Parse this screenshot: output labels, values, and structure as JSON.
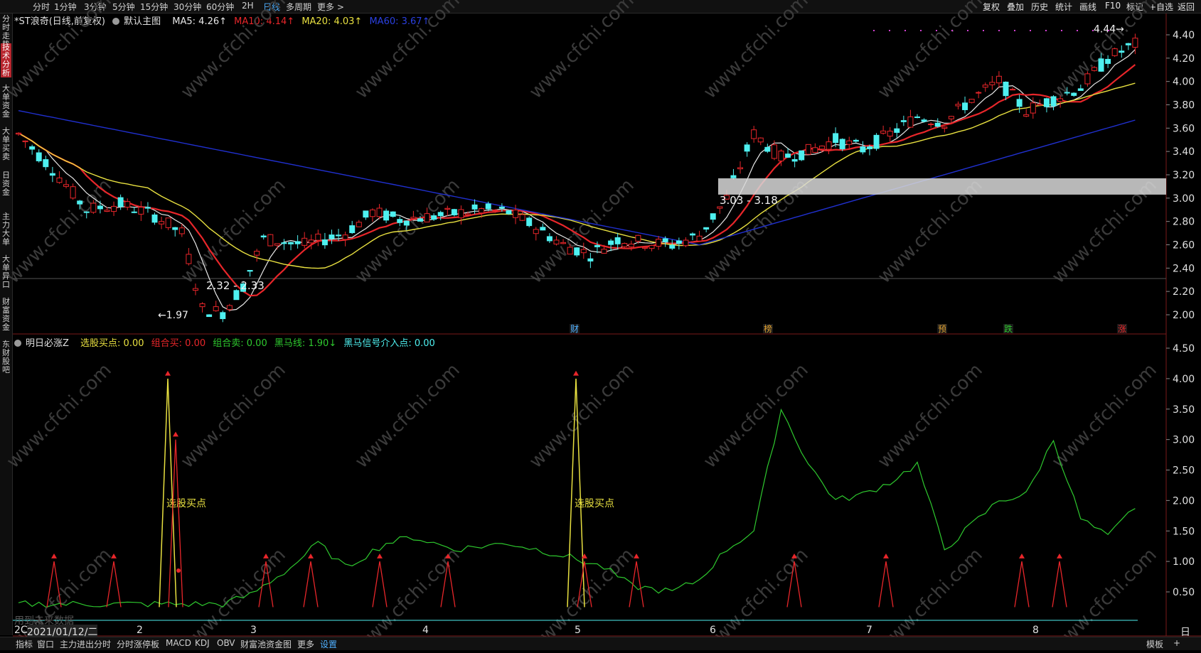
{
  "topbar": {
    "left_tabs": [
      "分时",
      "1分钟",
      "3分钟",
      "5分钟",
      "15分钟",
      "30分钟",
      "60分钟",
      "2H",
      "日线",
      "多周期",
      "更多 >"
    ],
    "active_tab": "日线",
    "right_tabs": [
      "复权",
      "叠加",
      "历史",
      "统计",
      "画线",
      "F10",
      "标记",
      "+自选",
      "返回"
    ]
  },
  "sidebar": {
    "items": [
      "分时走势",
      "技术分析",
      "大单资金",
      "大单买卖",
      "日资金",
      "主力大单",
      "大单异口",
      "财富资金",
      "东财股吧"
    ],
    "active_index": 1
  },
  "main": {
    "stock_title": "*ST浪奇(日线,前复权)",
    "template_label": "默认主图",
    "ma5": "MA5: 4.26↑",
    "ma10": "MA10: 4.14↑",
    "ma20": "MA20: 4.03↑",
    "ma60": "MA60: 3.67↑",
    "colors": {
      "up": "#e8262a",
      "down": "#4ef0f0",
      "ma5": "#e8e8e8",
      "ma10": "#e8262a",
      "ma20": "#e8e040",
      "ma60": "#2030d0",
      "grid": "#7a1a1a"
    },
    "y_ticks": [
      "4.40",
      "4.20",
      "4.00",
      "3.80",
      "3.60",
      "3.40",
      "3.20",
      "3.00",
      "2.80",
      "2.60",
      "2.40",
      "2.20",
      "2.00"
    ],
    "annotations": {
      "high": "4.44",
      "low": "1.97",
      "range1": "2.32 - 2.33",
      "range2": "3.03 - 3.18"
    },
    "event_tags": [
      "财",
      "榜",
      "预",
      "跌",
      "涨"
    ]
  },
  "indicator": {
    "name": "明日必涨Z",
    "buy_point": "选股买点: 0.00",
    "combo_buy": "组合买: 0.00",
    "combo_sell": "组合卖: 0.00",
    "dark_horse": "黑马线: 1.90↓",
    "dark_horse_signal": "黑马信号介入点: 0.00",
    "buy_label": "选股买点",
    "y_ticks": [
      "4.50",
      "4.00",
      "3.50",
      "3.00",
      "2.50",
      "2.00",
      "1.50",
      "1.00",
      "0.50"
    ],
    "note": "用到未来数据"
  },
  "xaxis": {
    "date": "2021/01/12/二",
    "prefix": "2C",
    "months": [
      "2",
      "3",
      "4",
      "5",
      "6",
      "7",
      "8"
    ],
    "period": "日线"
  },
  "bottombar": {
    "items": [
      "指标",
      "窗口",
      "主力进出分时",
      "分时涨停板",
      "MACD",
      "KDJ",
      "OBV",
      "财富池资金图",
      "更多",
      "设置"
    ],
    "active": "设置",
    "right_items": [
      "模板",
      "+"
    ]
  },
  "watermark": "www.cfchi.com"
}
